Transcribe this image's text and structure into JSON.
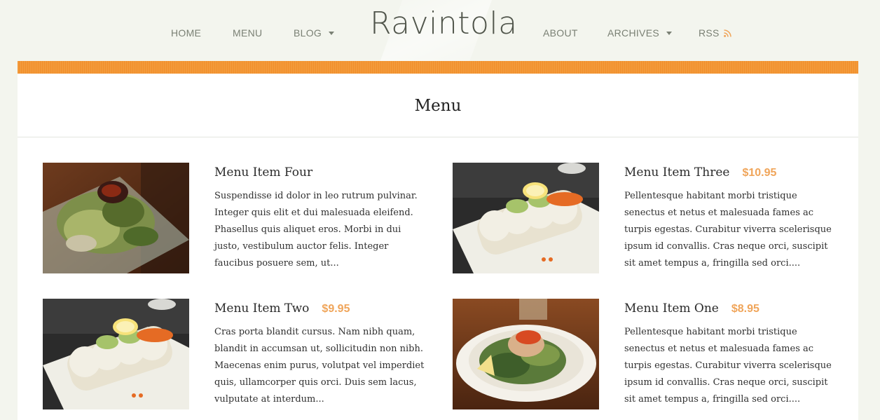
{
  "site": {
    "title": "Ravintola"
  },
  "nav": {
    "home": "HOME",
    "menu": "MENU",
    "blog": "BLOG",
    "about": "ABOUT",
    "archives": "ARCHIVES",
    "rss": "RSS"
  },
  "page": {
    "title": "Menu"
  },
  "colors": {
    "accent": "#f39a3a",
    "price": "#f0a55a",
    "background": "#f3f5ee"
  },
  "items": [
    {
      "title": "Menu Item Four",
      "price": "",
      "image": "salad-plate-photo",
      "description": "Suspendisse id dolor in leo rutrum pulvinar. Integer quis elit et dui malesuada eleifend. Phasellus quis aliquet eros. Morbi in dui justo, vestibulum auctor felis. Integer faucibus posuere sem, ut..."
    },
    {
      "title": "Menu Item Three",
      "price": "$10.95",
      "image": "sushi-roll-photo",
      "description": "Pellentesque habitant morbi tristique senectus et netus et malesuada fames ac turpis egestas. Curabitur viverra scelerisque ipsum id convallis. Cras neque orci, suscipit sit amet tempus a, fringilla sed orci...."
    },
    {
      "title": "Menu Item Two",
      "price": "$9.95",
      "image": "sushi-roll-photo",
      "description": "Cras porta blandit cursus. Nam nibh quam, blandit in accumsan ut, sollicitudin non nibh. Maecenas enim purus, volutpat vel imperdiet quis, ullamcorper quis orci. Duis sem lacus, vulputate at interdum..."
    },
    {
      "title": "Menu Item One",
      "price": "$8.95",
      "image": "salad-bowl-photo",
      "description": "Pellentesque habitant morbi tristique senectus et netus et malesuada fames ac turpis egestas. Curabitur viverra scelerisque ipsum id convallis. Cras neque orci, suscipit sit amet tempus a, fringilla sed orci...."
    }
  ]
}
